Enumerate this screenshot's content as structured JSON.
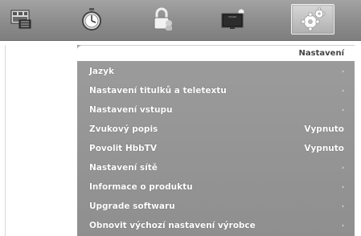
{
  "top_icons": [
    {
      "name": "media-browser-icon",
      "selected": false
    },
    {
      "name": "timer-icon",
      "selected": false
    },
    {
      "name": "parental-lock-icon",
      "selected": false
    },
    {
      "name": "tv-display-icon",
      "selected": false
    },
    {
      "name": "settings-gears-icon",
      "selected": true
    }
  ],
  "menu": {
    "title": "Nastavení",
    "items": [
      {
        "label": "Jazyk",
        "value": "›"
      },
      {
        "label": "Nastavení titulků a teletextu",
        "value": "›"
      },
      {
        "label": "Nastavení vstupu",
        "value": "›"
      },
      {
        "label": "Zvukový popis",
        "value": "Vypnuto"
      },
      {
        "label": "Povolit HbbTV",
        "value": "Vypnuto"
      },
      {
        "label": "Nastavení sítě",
        "value": "›"
      },
      {
        "label": "Informace o produktu",
        "value": "›"
      },
      {
        "label": "Upgrade softwaru",
        "value": "›"
      },
      {
        "label": "Obnovit výchozí nastavení výrobce",
        "value": "›"
      }
    ]
  }
}
